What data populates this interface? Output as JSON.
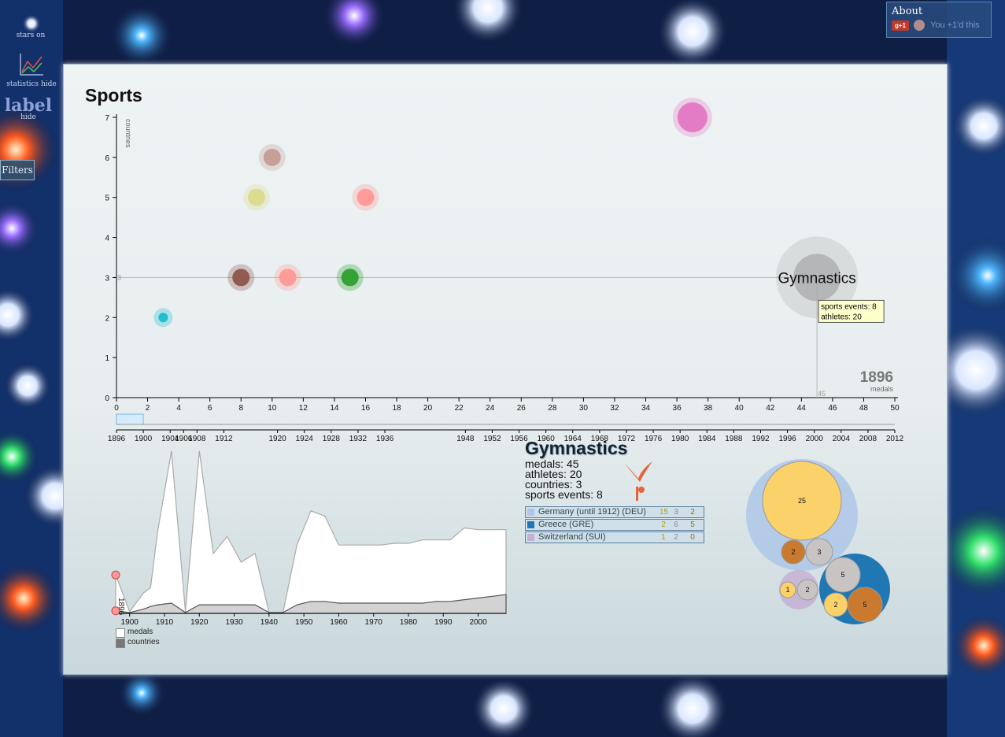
{
  "controls": {
    "stars": "stars on",
    "statistics": "statistics hide",
    "label_big": "label",
    "label_small": "hide",
    "filters": "Filters"
  },
  "about": {
    "title": "About",
    "gplus": "+1",
    "note": "You +1'd this"
  },
  "chart_title": "Sports",
  "chart_data": {
    "type": "scatter",
    "title": "Sports",
    "xlabel": "medals",
    "ylabel": "countries",
    "xlim": [
      0,
      50
    ],
    "ylim": [
      0,
      7
    ],
    "xticks": [
      "0",
      "2",
      "4",
      "6",
      "8",
      "10",
      "12",
      "14",
      "16",
      "18",
      "20",
      "22",
      "24",
      "26",
      "28",
      "30",
      "32",
      "34",
      "36",
      "38",
      "40",
      "42",
      "44",
      "46",
      "48",
      "50"
    ],
    "yticks": [
      "0",
      "1",
      "2",
      "3",
      "4",
      "5",
      "6",
      "7"
    ],
    "year_label": "1896",
    "points": [
      {
        "x": 3,
        "y": 2,
        "color": "#17becf"
      },
      {
        "x": 8,
        "y": 3,
        "color": "#8c564b"
      },
      {
        "x": 9,
        "y": 5,
        "color": "#dbdb8d"
      },
      {
        "x": 10,
        "y": 6,
        "color": "#c49c94"
      },
      {
        "x": 11,
        "y": 3,
        "color": "#ff9896"
      },
      {
        "x": 15,
        "y": 3,
        "color": "#2ca02c"
      },
      {
        "x": 16,
        "y": 5,
        "color": "#ff9896"
      },
      {
        "x": 37,
        "y": 7,
        "color": "#e377c2"
      },
      {
        "x": 45,
        "y": 3,
        "color": "#aaaaaa",
        "label": "Gymnastics"
      }
    ],
    "crosshair": {
      "x_value": "45",
      "y_value": "3"
    },
    "tooltip": [
      "sports events: 8",
      "athletes: 20"
    ],
    "timeline_years": [
      "1896",
      "1900",
      "1904",
      "1906",
      "1908",
      "1912",
      "1920",
      "1924",
      "1928",
      "1932",
      "1936",
      "1948",
      "1952",
      "1956",
      "1960",
      "1964",
      "1968",
      "1972",
      "1976",
      "1980",
      "1984",
      "1988",
      "1992",
      "1996",
      "2000",
      "2004",
      "2008",
      "2012"
    ],
    "history": {
      "x_ticks": [
        "1900",
        "1910",
        "1920",
        "1930",
        "1940",
        "1950",
        "1960",
        "1970",
        "1980",
        "1990",
        "2000"
      ],
      "current_year": "1896",
      "series": [
        {
          "name": "medals",
          "x": [
            1896,
            1900,
            1904,
            1906,
            1908,
            1912,
            1916,
            1920,
            1924,
            1928,
            1932,
            1936,
            1940,
            1944,
            1948,
            1952,
            1956,
            1960,
            1964,
            1968,
            1972,
            1976,
            1980,
            1984,
            1988,
            1992,
            1996,
            2000,
            2004,
            2008
          ],
          "values": [
            45,
            2,
            24,
            30,
            95,
            190,
            2,
            190,
            70,
            90,
            60,
            70,
            1,
            1,
            80,
            120,
            114,
            80,
            80,
            80,
            80,
            82,
            82,
            86,
            86,
            86,
            100,
            98,
            98,
            98
          ]
        },
        {
          "name": "countries",
          "x": [
            1896,
            1900,
            1904,
            1906,
            1908,
            1912,
            1916,
            1920,
            1924,
            1928,
            1932,
            1936,
            1940,
            1944,
            1948,
            1952,
            1956,
            1960,
            1964,
            1968,
            1972,
            1976,
            1980,
            1984,
            1988,
            1992,
            1996,
            2000,
            2004,
            2008
          ],
          "values": [
            3,
            1,
            5,
            8,
            10,
            12,
            1,
            10,
            10,
            10,
            10,
            10,
            1,
            1,
            10,
            14,
            14,
            12,
            12,
            12,
            12,
            12,
            12,
            12,
            14,
            14,
            16,
            18,
            20,
            22
          ]
        }
      ]
    }
  },
  "info": {
    "name": "Gymnastics",
    "stats": [
      "medals: 45",
      "athletes: 20",
      "countries: 3",
      "sports events: 8"
    ]
  },
  "countries": [
    {
      "name": "Germany (until 1912) (DEU)",
      "color": "#aec7e8",
      "medals": [
        "15",
        "3",
        "2"
      ]
    },
    {
      "name": "Greece (GRE)",
      "color": "#1f77b4",
      "medals": [
        "2",
        "6",
        "5"
      ]
    },
    {
      "name": "Switzerland (SUI)",
      "color": "#c5b0d5",
      "medals": [
        "1",
        "2",
        "0"
      ]
    }
  ],
  "pack": [
    {
      "color": "#aec7e8",
      "medals": [
        25,
        2,
        3
      ]
    },
    {
      "color": "#c5b0d5",
      "medals": [
        1,
        2
      ]
    },
    {
      "color": "#1f77b4",
      "medals": [
        5,
        2,
        5
      ]
    }
  ],
  "legend": {
    "medals": "medals",
    "countries": "countries"
  },
  "colors": {
    "gold": "#fbd26a",
    "silver": "#c8c4c4",
    "bronze": "#c97a2f",
    "accent": "#e8623a"
  }
}
